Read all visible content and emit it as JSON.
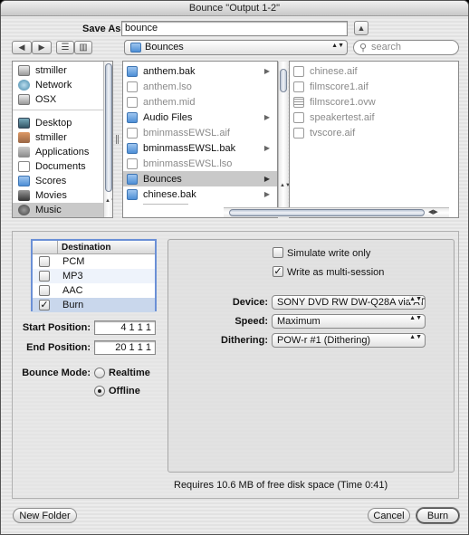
{
  "window": {
    "title": "Bounce \"Output 1-2\""
  },
  "save": {
    "label": "Save As:",
    "value": "bounce",
    "expand_glyph": "▲"
  },
  "toolbar": {
    "back_glyph": "◀",
    "forward_glyph": "▶",
    "list_view_glyph": "☰",
    "column_view_glyph": "▥",
    "location": "Bounces",
    "search_placeholder": "search"
  },
  "sidebar": {
    "items": [
      {
        "label": "stmiller",
        "icon": "hard-disk-icon"
      },
      {
        "label": "Network",
        "icon": "globe-icon"
      },
      {
        "label": "OSX",
        "icon": "hard-disk-icon"
      },
      {
        "label": "Desktop",
        "icon": "desktop-icon"
      },
      {
        "label": "stmiller",
        "icon": "home-icon"
      },
      {
        "label": "Applications",
        "icon": "applications-icon"
      },
      {
        "label": "Documents",
        "icon": "documents-icon"
      },
      {
        "label": "Scores",
        "icon": "folder-icon"
      },
      {
        "label": "Movies",
        "icon": "movies-icon"
      },
      {
        "label": "Music",
        "icon": "music-icon"
      }
    ]
  },
  "column1": {
    "items": [
      {
        "label": "anthem.bak",
        "type": "folder",
        "dim": false,
        "arrow": true
      },
      {
        "label": "anthem.lso",
        "type": "doc",
        "dim": true,
        "arrow": false
      },
      {
        "label": "anthem.mid",
        "type": "doc",
        "dim": true,
        "arrow": false
      },
      {
        "label": "Audio Files",
        "type": "folder",
        "dim": false,
        "arrow": true
      },
      {
        "label": "bminmassEWSL.aif",
        "type": "doc",
        "dim": true,
        "arrow": false
      },
      {
        "label": "bminmassEWSL.bak",
        "type": "folder",
        "dim": false,
        "arrow": true
      },
      {
        "label": "bminmassEWSL.lso",
        "type": "doc",
        "dim": true,
        "arrow": false
      },
      {
        "label": "Bounces",
        "type": "folder",
        "dim": false,
        "arrow": true,
        "selected": true
      },
      {
        "label": "chinese.bak",
        "type": "folder",
        "dim": false,
        "arrow": true
      }
    ],
    "arrow_glyph": "▶"
  },
  "column2": {
    "items": [
      {
        "label": "chinese.aif"
      },
      {
        "label": "filmscore1.aif"
      },
      {
        "label": "filmscore1.ovw"
      },
      {
        "label": "speakertest.aif"
      },
      {
        "label": "tvscore.aif"
      }
    ]
  },
  "options": {
    "table_header": "Destination",
    "destinations": [
      {
        "label": "PCM",
        "checked": false
      },
      {
        "label": "MP3",
        "checked": false
      },
      {
        "label": "AAC",
        "checked": false
      },
      {
        "label": "Burn",
        "checked": true
      }
    ],
    "check_glyph": "✓",
    "start_label": "Start Position:",
    "start_value": "4 1 1 1",
    "end_label": "End Position:",
    "end_value": "20 1 1 1",
    "mode_label": "Bounce Mode:",
    "mode_realtime": "Realtime",
    "mode_offline": "Offline",
    "mode_selected": "Offline",
    "simulate_label": "Simulate write only",
    "simulate_checked": false,
    "multisession_label": "Write as multi-session",
    "multisession_checked": true,
    "device_label": "Device:",
    "device_value": "SONY DVD RW DW-Q28A via AT",
    "speed_label": "Speed:",
    "speed_value": "Maximum",
    "dithering_label": "Dithering:",
    "dithering_value": "POW-r #1 (Dithering)",
    "popup_arrows": "▲▼",
    "requirement": "Requires 10.6 MB of free disk space  (Time 0:41)"
  },
  "buttons": {
    "new_folder": "New Folder",
    "cancel": "Cancel",
    "burn": "Burn"
  },
  "colors": {
    "selection": "#6b90d6",
    "row_highlight": "#c9d7ec"
  }
}
